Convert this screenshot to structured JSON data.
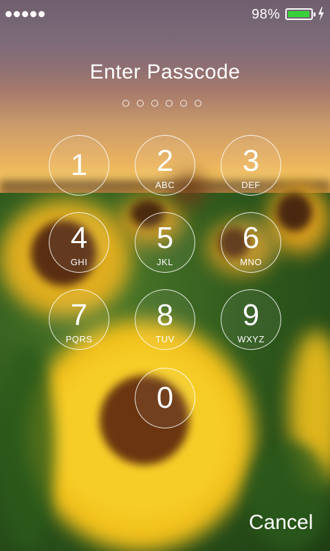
{
  "status_bar": {
    "signal_icon": "signal-dots-icon",
    "battery_percent": "98%",
    "battery_level": 0.98,
    "battery_color": "#38d13a",
    "charging_icon": "lightning-bolt-icon"
  },
  "passcode": {
    "title": "Enter Passcode",
    "digit_count": 6,
    "entered": 0
  },
  "keypad": {
    "keys": [
      {
        "digit": "1",
        "letters": ""
      },
      {
        "digit": "2",
        "letters": "ABC"
      },
      {
        "digit": "3",
        "letters": "DEF"
      },
      {
        "digit": "4",
        "letters": "GHI"
      },
      {
        "digit": "5",
        "letters": "JKL"
      },
      {
        "digit": "6",
        "letters": "MNO"
      },
      {
        "digit": "7",
        "letters": "PQRS"
      },
      {
        "digit": "8",
        "letters": "TUV"
      },
      {
        "digit": "9",
        "letters": "WXYZ"
      },
      {
        "digit": "0",
        "letters": ""
      }
    ]
  },
  "footer": {
    "cancel_label": "Cancel"
  }
}
